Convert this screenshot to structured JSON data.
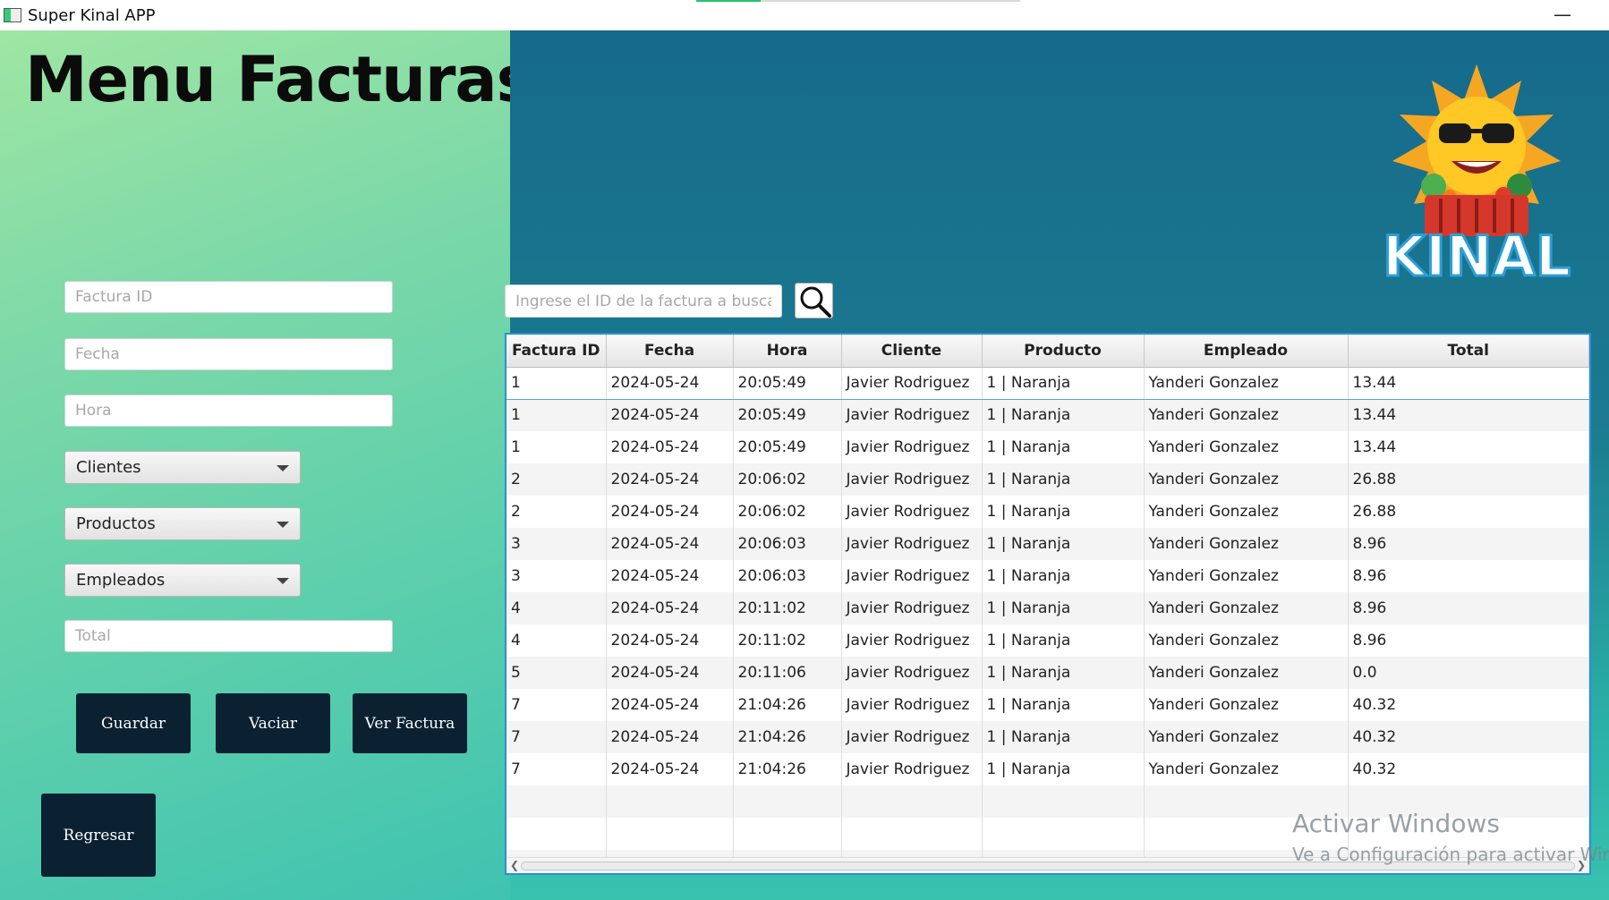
{
  "window": {
    "title": "Super Kinal APP",
    "minimize_label": "—"
  },
  "main_title": "Menu Facturas",
  "form": {
    "factura_id_placeholder": "Factura ID",
    "fecha_placeholder": "Fecha",
    "hora_placeholder": "Hora",
    "clientes_label": "Clientes",
    "productos_label": "Productos",
    "empleados_label": "Empleados",
    "total_placeholder": "Total"
  },
  "buttons": {
    "guardar": "Guardar",
    "vaciar": "Vaciar",
    "ver_factura": "Ver Factura",
    "regresar": "Regresar"
  },
  "search": {
    "placeholder": "Ingrese el ID de la factura a buscar",
    "icon": "magnifier-icon"
  },
  "logo": {
    "text": "KINAL"
  },
  "table": {
    "columns": [
      "Factura ID",
      "Fecha",
      "Hora",
      "Cliente",
      "Producto",
      "Empleado",
      "Total"
    ],
    "rows": [
      [
        "1",
        "2024-05-24",
        "20:05:49",
        "Javier Rodriguez",
        "1 | Naranja",
        "Yanderi Gonzalez",
        "13.44"
      ],
      [
        "1",
        "2024-05-24",
        "20:05:49",
        "Javier Rodriguez",
        "1 | Naranja",
        "Yanderi Gonzalez",
        "13.44"
      ],
      [
        "1",
        "2024-05-24",
        "20:05:49",
        "Javier Rodriguez",
        "1 | Naranja",
        "Yanderi Gonzalez",
        "13.44"
      ],
      [
        "2",
        "2024-05-24",
        "20:06:02",
        "Javier Rodriguez",
        "1 | Naranja",
        "Yanderi Gonzalez",
        "26.88"
      ],
      [
        "2",
        "2024-05-24",
        "20:06:02",
        "Javier Rodriguez",
        "1 | Naranja",
        "Yanderi Gonzalez",
        "26.88"
      ],
      [
        "3",
        "2024-05-24",
        "20:06:03",
        "Javier Rodriguez",
        "1 | Naranja",
        "Yanderi Gonzalez",
        "8.96"
      ],
      [
        "3",
        "2024-05-24",
        "20:06:03",
        "Javier Rodriguez",
        "1 | Naranja",
        "Yanderi Gonzalez",
        "8.96"
      ],
      [
        "4",
        "2024-05-24",
        "20:11:02",
        "Javier Rodriguez",
        "1 | Naranja",
        "Yanderi Gonzalez",
        "8.96"
      ],
      [
        "4",
        "2024-05-24",
        "20:11:02",
        "Javier Rodriguez",
        "1 | Naranja",
        "Yanderi Gonzalez",
        "8.96"
      ],
      [
        "5",
        "2024-05-24",
        "20:11:06",
        "Javier Rodriguez",
        "1 | Naranja",
        "Yanderi Gonzalez",
        "0.0"
      ],
      [
        "7",
        "2024-05-24",
        "21:04:26",
        "Javier Rodriguez",
        "1 | Naranja",
        "Yanderi Gonzalez",
        "40.32"
      ],
      [
        "7",
        "2024-05-24",
        "21:04:26",
        "Javier Rodriguez",
        "1 | Naranja",
        "Yanderi Gonzalez",
        "40.32"
      ],
      [
        "7",
        "2024-05-24",
        "21:04:26",
        "Javier Rodriguez",
        "1 | Naranja",
        "Yanderi Gonzalez",
        "40.32"
      ]
    ],
    "empty_rows": 3
  },
  "watermark": {
    "line1": "Activar Windows",
    "line2": "Ve a Configuración para activar Windows."
  },
  "colors": {
    "button_bg": "#0b2132",
    "table_border": "#2a8fd8",
    "left_gradient_top": "#9ee6a3",
    "right_gradient_top": "#166a8c"
  }
}
